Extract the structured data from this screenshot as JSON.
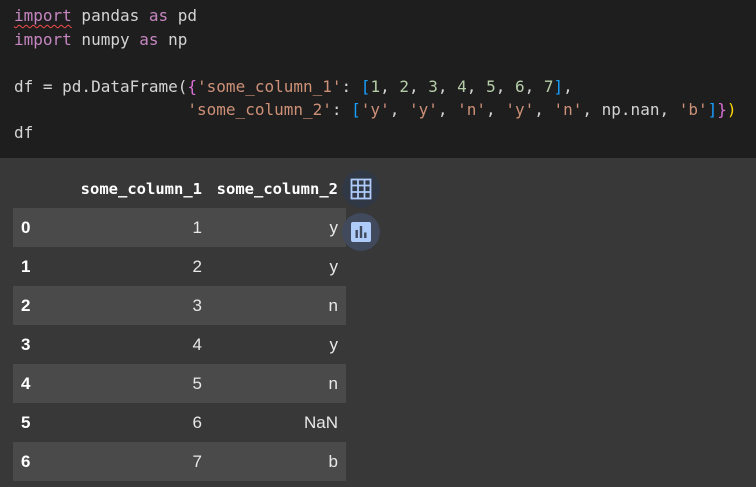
{
  "code": {
    "line1": {
      "kw": "import",
      "mod": " pandas ",
      "as": "as",
      "alias": " pd"
    },
    "line2": {
      "kw": "import",
      "mod": " numpy ",
      "as": "as",
      "alias": " np"
    },
    "line4": {
      "pre": "df = pd.DataFrame(",
      "b1": "(",
      "b2": "{",
      "key1": "'some_column_1'",
      "colon": ": ",
      "b3": "[",
      "n1": "1",
      "n2": "2",
      "n3": "3",
      "n4": "4",
      "n5": "5",
      "n6": "6",
      "n7": "7",
      "sep": ", ",
      "b3c": "]",
      "tail": ","
    },
    "line5": {
      "indent": "                  ",
      "key2": "'some_column_2'",
      "colon": ": ",
      "b3": "[",
      "s1": "'y'",
      "s2": "'y'",
      "s3": "'n'",
      "s4": "'y'",
      "s5": "'n'",
      "nan": "np.nan",
      "s6": "'b'",
      "sep": ", ",
      "b3c": "]",
      "b2c": "}",
      "b1c": ")"
    },
    "line6": "df"
  },
  "table": {
    "columns": [
      "some_column_1",
      "some_column_2"
    ],
    "rows": [
      {
        "index": "0",
        "c1": "1",
        "c2": "y"
      },
      {
        "index": "1",
        "c1": "2",
        "c2": "y"
      },
      {
        "index": "2",
        "c1": "3",
        "c2": "n"
      },
      {
        "index": "3",
        "c1": "4",
        "c2": "y"
      },
      {
        "index": "4",
        "c1": "5",
        "c2": "n"
      },
      {
        "index": "5",
        "c1": "6",
        "c2": "NaN"
      },
      {
        "index": "6",
        "c1": "7",
        "c2": "b"
      }
    ]
  },
  "buttons": {
    "table_icon": "table-icon",
    "chart_icon": "bar-chart-icon"
  },
  "colors": {
    "keyword": "#c586c0",
    "string": "#ce9178",
    "number": "#b5cea8",
    "bracket_level1": "#ffd700",
    "bracket_level2": "#da70d6",
    "bracket_level3": "#179fff",
    "icon_accent": "#aecbfa"
  }
}
